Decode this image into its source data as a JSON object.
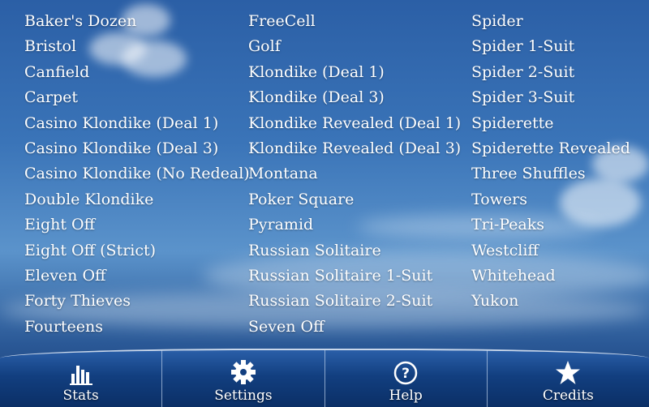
{
  "colors": {
    "text": "#ffffff",
    "sky_top": "#2b5fa6",
    "toolbar": "#123f80",
    "divider": "#c9d7ea"
  },
  "games": {
    "column1": [
      "Baker's Dozen",
      "Bristol",
      "Canfield",
      "Carpet",
      "Casino Klondike (Deal 1)",
      "Casino Klondike (Deal 3)",
      "Casino Klondike (No Redeal)",
      "Double Klondike",
      "Eight Off",
      "Eight Off (Strict)",
      "Eleven Off",
      "Forty Thieves",
      "Fourteens"
    ],
    "column2": [
      "FreeCell",
      "Golf",
      "Klondike (Deal 1)",
      "Klondike (Deal 3)",
      "Klondike Revealed (Deal 1)",
      "Klondike Revealed (Deal 3)",
      "Montana",
      "Poker Square",
      "Pyramid",
      "Russian Solitaire",
      "Russian Solitaire 1-Suit",
      "Russian Solitaire 2-Suit",
      "Seven Off"
    ],
    "column3": [
      "Spider",
      "Spider 1-Suit",
      "Spider 2-Suit",
      "Spider 3-Suit",
      "Spiderette",
      "Spiderette Revealed",
      "Three Shuffles",
      "Towers",
      "Tri-Peaks",
      "Westcliff",
      "Whitehead",
      "Yukon"
    ]
  },
  "toolbar": {
    "stats": {
      "label": "Stats",
      "icon": "bar-chart-icon"
    },
    "settings": {
      "label": "Settings",
      "icon": "gear-icon"
    },
    "help": {
      "label": "Help",
      "icon": "question-circle-icon"
    },
    "credits": {
      "label": "Credits",
      "icon": "star-icon"
    }
  }
}
